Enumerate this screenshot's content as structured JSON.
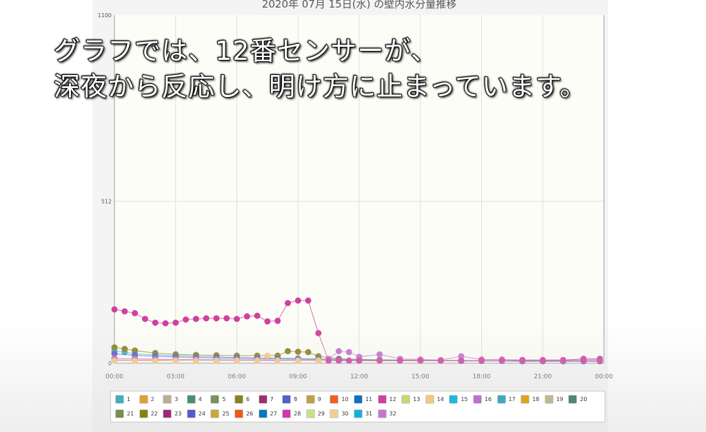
{
  "caption": {
    "line1": "グラフでは、12番センサーが、",
    "line2": "深夜から反応し、明け方に止まっています。"
  },
  "chart_data": {
    "type": "line",
    "title": "2020年 07月 15日(水) の壁内水分量推移",
    "xlabel": "",
    "ylabel": "",
    "xlim": [
      0,
      24
    ],
    "ylim": [
      0,
      1100
    ],
    "y_ticks": [
      "0",
      "512",
      "1100"
    ],
    "x_ticks": [
      "00:00",
      "03:00",
      "06:00",
      "09:00",
      "12:00",
      "15:00",
      "18:00",
      "21:00",
      "00:00"
    ],
    "grid": true,
    "legend": "bottom",
    "legend_labels": [
      "1",
      "2",
      "3",
      "4",
      "5",
      "6",
      "7",
      "8",
      "9",
      "10",
      "11",
      "12",
      "13",
      "14",
      "15",
      "16",
      "17",
      "18",
      "19",
      "20",
      "21",
      "22",
      "23",
      "24",
      "25",
      "26",
      "27",
      "28",
      "29",
      "30",
      "31",
      "32"
    ],
    "series_colors": [
      "#3cb0c0",
      "#e0a030",
      "#b8b090",
      "#4a9070",
      "#7a9060",
      "#8a8020",
      "#a03070",
      "#5060d0",
      "#c0a040",
      "#f06020",
      "#1070c0",
      "#d040a0",
      "#c8d870",
      "#f0c880",
      "#20b8e0",
      "#c070d0",
      "#40a8c0",
      "#e0a020",
      "#c0b890",
      "#508870",
      "#789050",
      "#8a8010",
      "#a02878",
      "#5858d0",
      "#c8a838",
      "#f05818",
      "#0878c0",
      "#d038a8",
      "#c8e080",
      "#f0d090",
      "#18b0d8",
      "#c078d0"
    ],
    "series": [
      {
        "name": "1",
        "x": [
          0,
          0.5,
          1,
          2,
          3,
          4,
          5,
          6,
          7,
          8,
          9,
          10,
          11,
          12,
          13,
          14,
          15,
          16,
          17,
          18,
          19,
          20,
          21,
          22,
          23,
          23.8
        ],
        "values": [
          40,
          35,
          30,
          26,
          24,
          22,
          20,
          18,
          17,
          16,
          15,
          14,
          13,
          12,
          11,
          10,
          10,
          9,
          9,
          8,
          8,
          8,
          7,
          7,
          7,
          7
        ]
      },
      {
        "name": "6",
        "x": [
          0,
          0.5,
          1,
          2,
          3,
          4,
          5,
          6,
          7,
          8,
          8.5,
          9,
          9.5,
          10,
          11,
          12,
          13,
          14,
          15,
          16,
          17,
          18,
          19,
          20,
          21,
          22,
          23,
          23.8
        ],
        "values": [
          50,
          45,
          40,
          32,
          28,
          26,
          25,
          24,
          24,
          24,
          38,
          36,
          35,
          22,
          14,
          12,
          10,
          10,
          9,
          9,
          8,
          8,
          8,
          7,
          7,
          7,
          7,
          7
        ]
      },
      {
        "name": "8",
        "x": [
          0,
          1,
          2,
          3,
          4,
          5,
          6,
          7,
          8,
          9,
          10,
          11,
          12,
          13,
          14,
          15,
          16,
          17,
          18,
          19,
          20,
          21,
          22,
          23,
          23.8
        ],
        "values": [
          30,
          25,
          22,
          20,
          18,
          17,
          16,
          15,
          14,
          13,
          12,
          11,
          10,
          9,
          9,
          8,
          8,
          7,
          7,
          7,
          6,
          6,
          6,
          6,
          6
        ]
      },
      {
        "name": "12",
        "x": [
          0,
          0.5,
          1,
          1.5,
          2,
          2.5,
          3,
          3.5,
          4,
          4.5,
          5,
          5.5,
          6,
          6.5,
          7,
          7.5,
          8,
          8.5,
          9,
          9.5,
          10,
          10.5,
          11,
          11.5,
          12,
          13,
          14,
          15,
          16,
          17,
          18,
          19,
          20,
          21,
          22,
          23,
          23.8
        ],
        "values": [
          170,
          164,
          158,
          140,
          128,
          126,
          128,
          138,
          140,
          142,
          142,
          142,
          140,
          148,
          150,
          132,
          134,
          190,
          198,
          198,
          95,
          8,
          8,
          8,
          8,
          8,
          8,
          8,
          8,
          8,
          8,
          8,
          8,
          8,
          8,
          8,
          8
        ]
      },
      {
        "name": "16",
        "x": [
          0,
          1,
          2,
          3,
          4,
          5,
          6,
          7,
          8,
          9,
          10,
          10.5,
          11,
          11.5,
          12,
          13,
          14,
          15,
          16,
          17,
          18,
          19,
          20,
          21,
          22,
          23,
          23.8
        ],
        "values": [
          15,
          14,
          13,
          12,
          12,
          11,
          11,
          11,
          10,
          10,
          10,
          14,
          38,
          35,
          20,
          28,
          14,
          12,
          10,
          22,
          12,
          12,
          10,
          10,
          10,
          12,
          12
        ]
      },
      {
        "name": "28",
        "x": [
          0,
          1,
          2,
          3,
          4,
          5,
          6,
          7,
          8,
          9,
          10,
          11,
          12,
          13,
          14,
          15,
          16,
          17,
          18,
          19,
          20,
          21,
          22,
          23,
          23.8
        ],
        "values": [
          10,
          10,
          10,
          9,
          9,
          9,
          9,
          9,
          9,
          9,
          8,
          8,
          8,
          8,
          8,
          8,
          8,
          8,
          8,
          8,
          10,
          10,
          10,
          14,
          14
        ]
      },
      {
        "name": "14",
        "x": [
          0,
          1,
          2,
          3,
          4,
          5,
          6,
          7,
          7.5,
          8,
          9,
          10,
          11,
          12,
          13,
          14,
          15,
          16,
          17,
          18,
          19,
          20,
          21,
          22,
          23,
          23.8
        ],
        "values": [
          8,
          8,
          8,
          8,
          8,
          8,
          8,
          8,
          24,
          8,
          8,
          8,
          8,
          8,
          8,
          8,
          8,
          8,
          8,
          8,
          8,
          8,
          8,
          8,
          8,
          8
        ]
      }
    ]
  }
}
